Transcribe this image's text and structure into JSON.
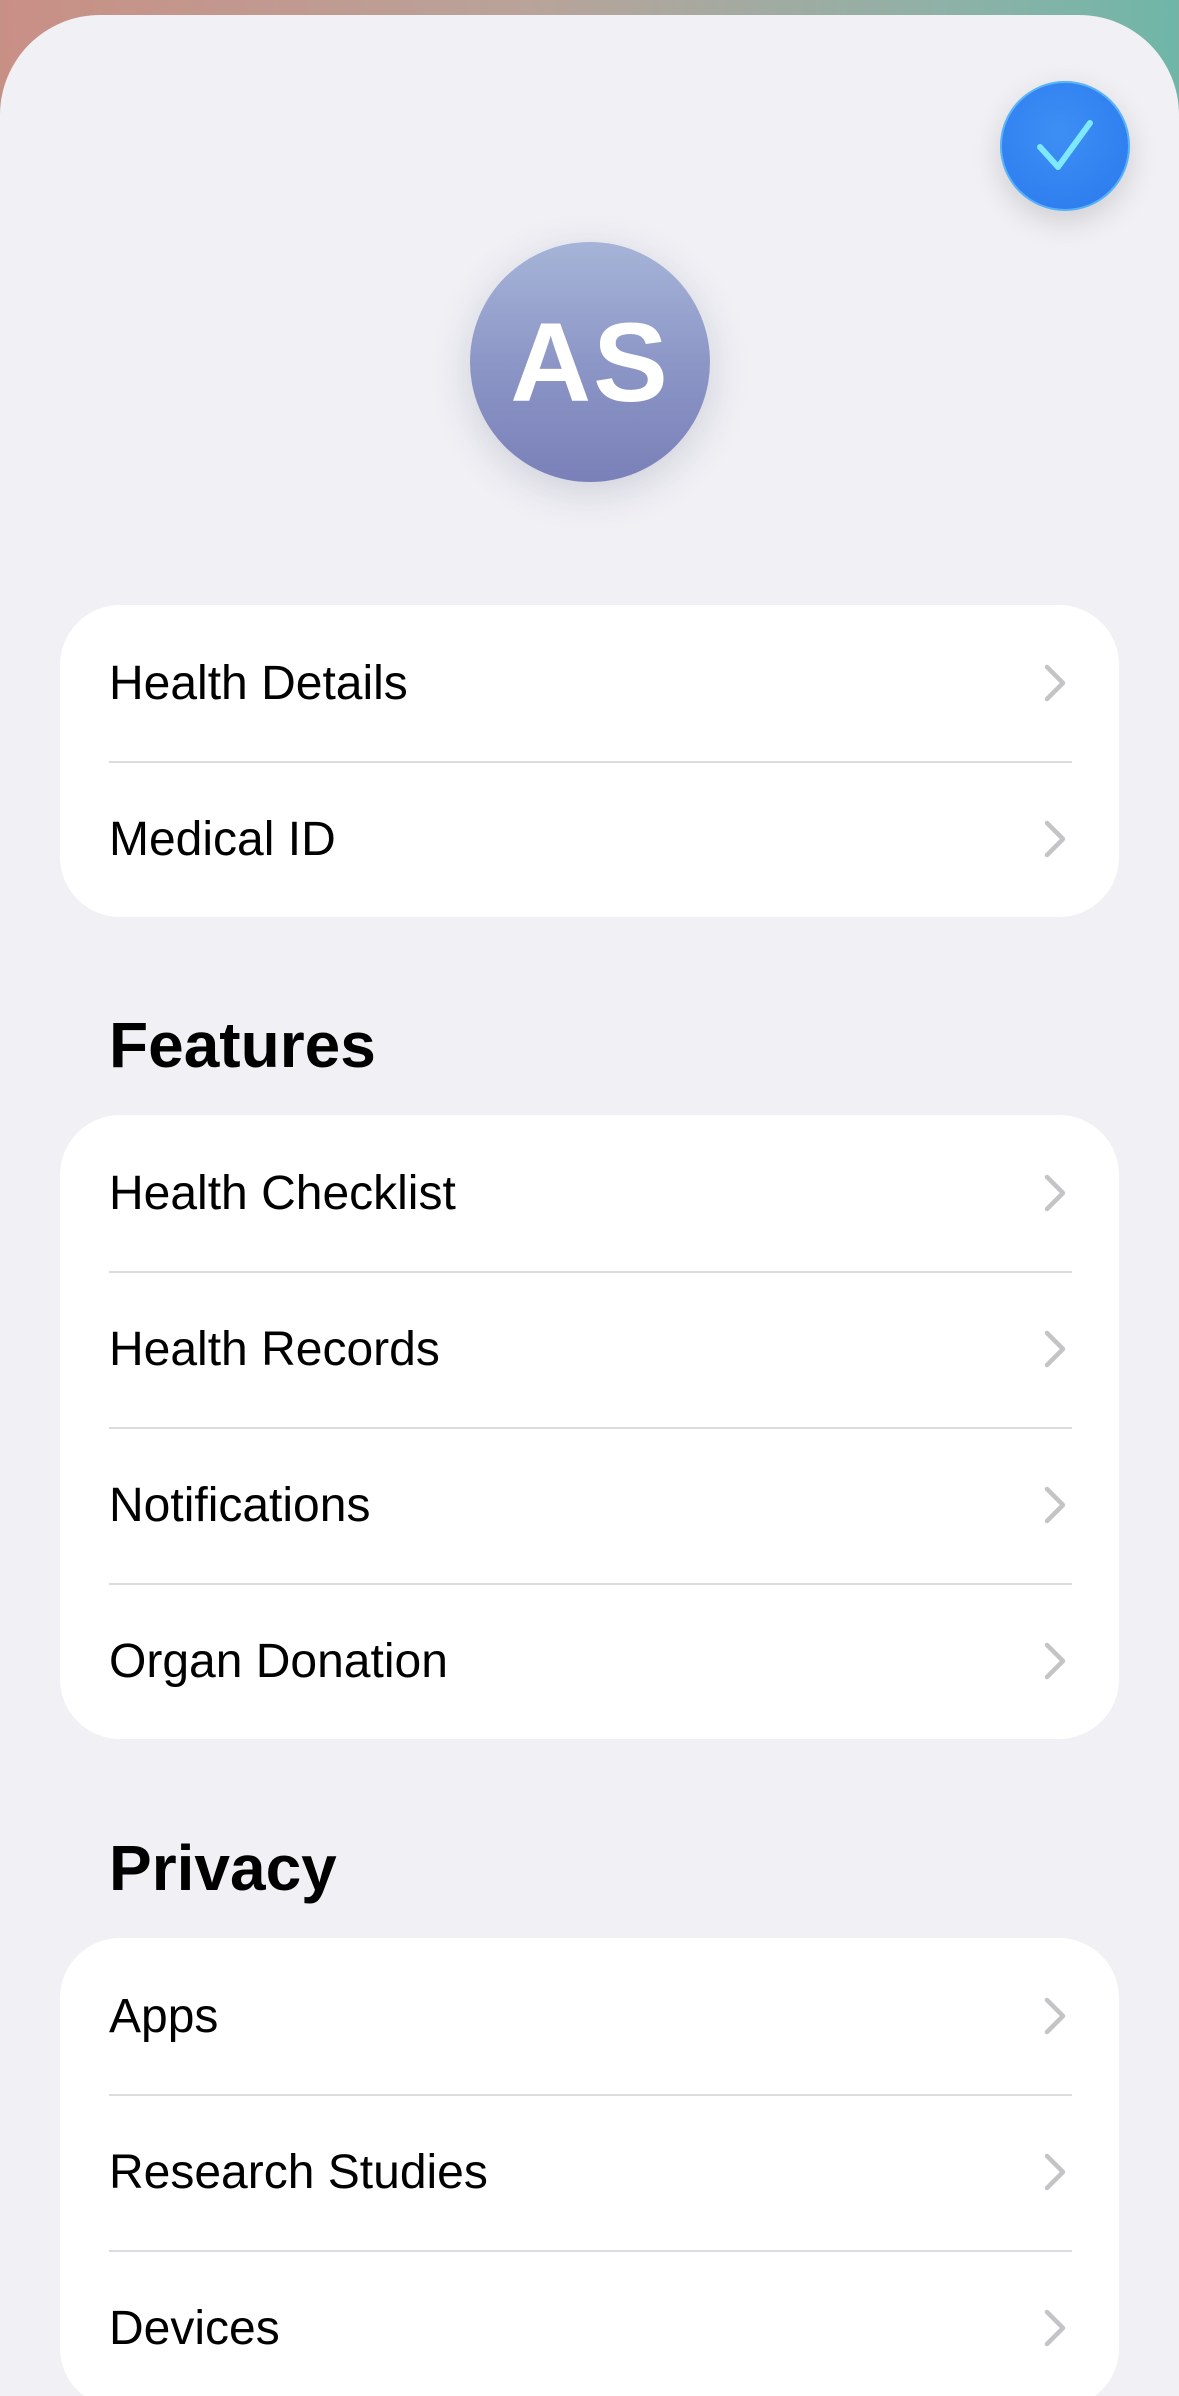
{
  "header": {
    "avatar_initials": "AS",
    "done_icon": "checkmark-icon"
  },
  "colors": {
    "accent": "#2f7ff0",
    "checkmark": "#7de8ff",
    "background": "#f0f0f5",
    "chevron": "#c4c4c7"
  },
  "profile_group": {
    "items": [
      {
        "label": "Health Details"
      },
      {
        "label": "Medical ID"
      }
    ]
  },
  "features": {
    "title": "Features",
    "items": [
      {
        "label": "Health Checklist"
      },
      {
        "label": "Health Records"
      },
      {
        "label": "Notifications"
      },
      {
        "label": "Organ Donation"
      }
    ]
  },
  "privacy": {
    "title": "Privacy",
    "items": [
      {
        "label": "Apps"
      },
      {
        "label": "Research Studies"
      },
      {
        "label": "Devices"
      }
    ]
  }
}
